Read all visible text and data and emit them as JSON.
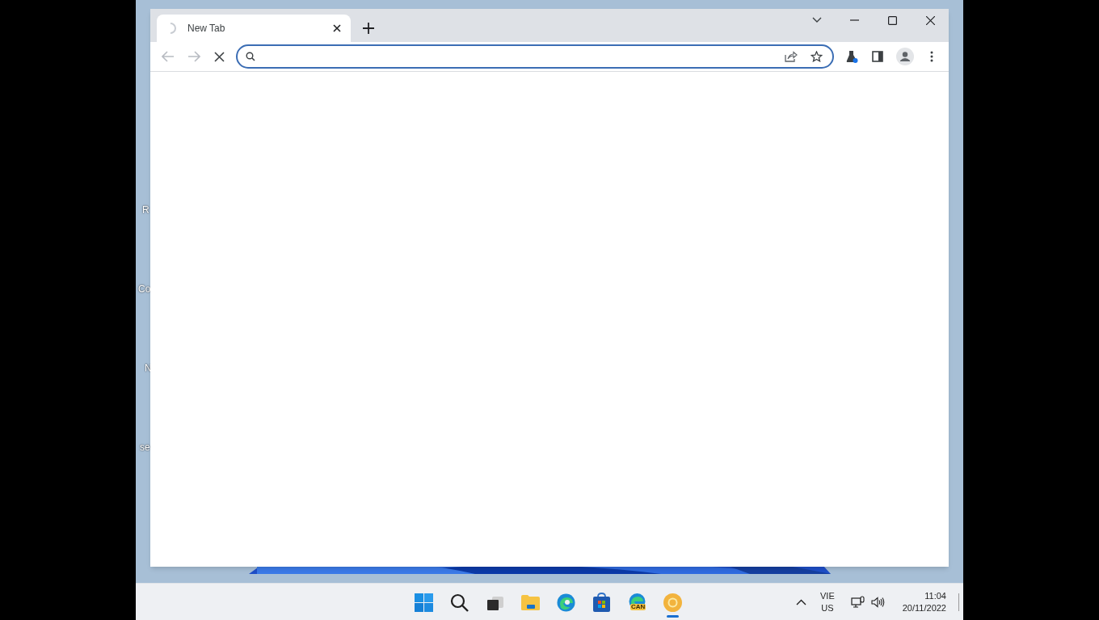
{
  "desktop_icons": [
    {
      "label": "R"
    },
    {
      "label": "Co"
    },
    {
      "label": "N"
    },
    {
      "label": "se"
    }
  ],
  "browser": {
    "tabs": [
      {
        "title": "New Tab",
        "selected": true,
        "loading": true
      }
    ],
    "navigation": [
      {
        "kind": "back",
        "disabled": true
      },
      {
        "kind": "forward",
        "disabled": true
      },
      {
        "kind": "stop",
        "disabled": false
      }
    ],
    "omnibox": {
      "focused": true
    },
    "toolbar_icons": [
      {
        "kind": "share"
      },
      {
        "kind": "star"
      },
      {
        "kind": "labs"
      },
      {
        "kind": "side-panel"
      },
      {
        "kind": "profile"
      },
      {
        "kind": "menu"
      }
    ]
  },
  "taskbar": {
    "apps": [
      {
        "kind": "start",
        "running": false
      },
      {
        "kind": "search",
        "running": false
      },
      {
        "kind": "task-view",
        "running": false
      },
      {
        "kind": "files",
        "running": false
      },
      {
        "kind": "edge",
        "running": false
      },
      {
        "kind": "store",
        "running": false
      },
      {
        "kind": "edge-canary",
        "badge": "CAN",
        "running": false
      },
      {
        "kind": "chrome-canary",
        "running": true
      }
    ],
    "language": "VIE",
    "keyboard": "US",
    "time": "11:04",
    "date": "20/11/2022"
  }
}
